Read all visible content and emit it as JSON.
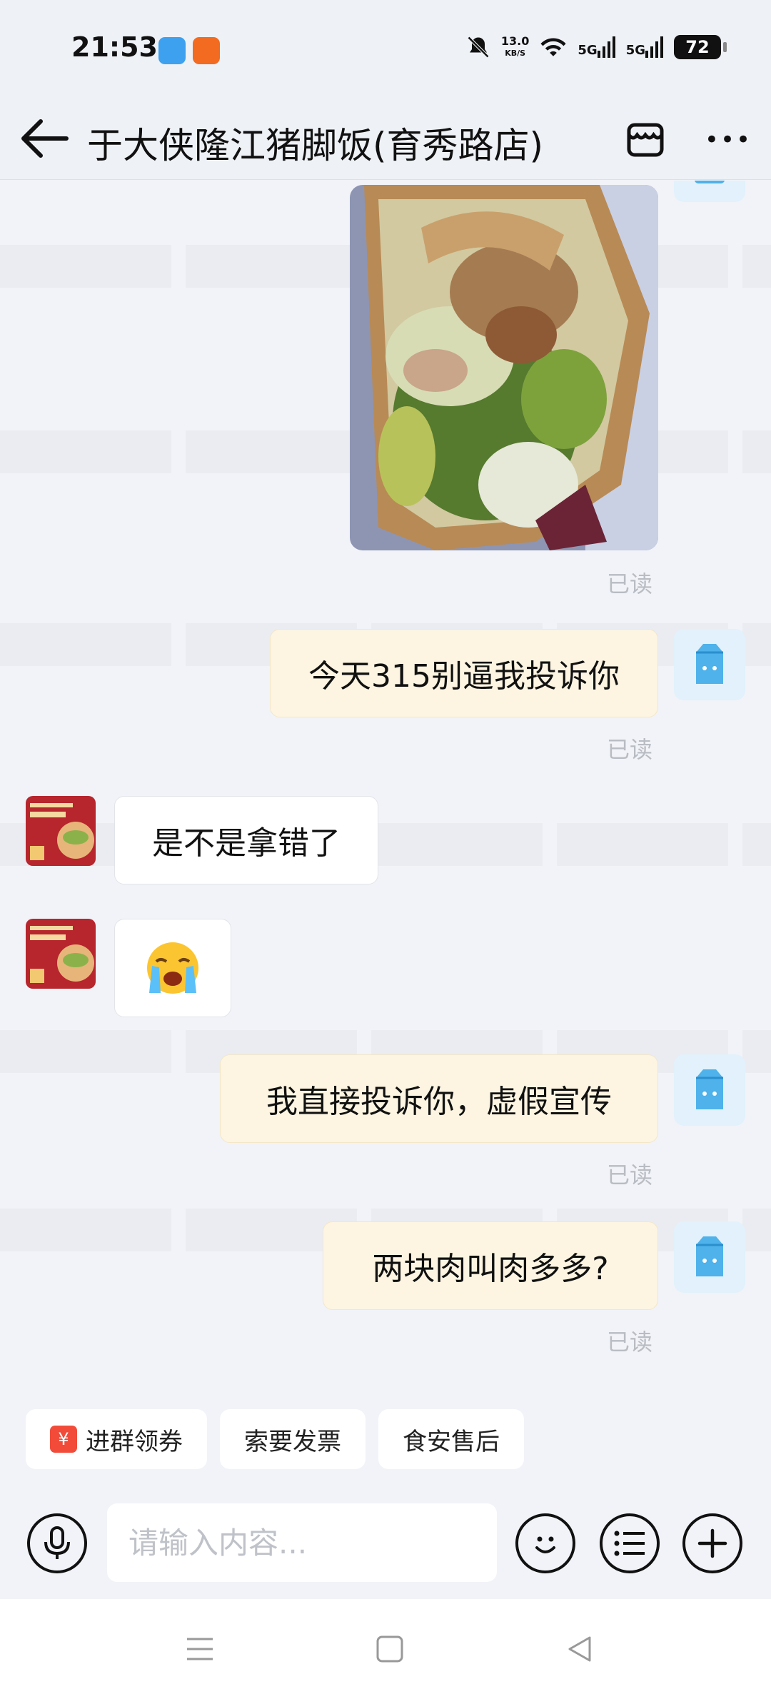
{
  "status_bar": {
    "time": "21:53",
    "app_badges": [
      {
        "name": "taobao-shangou-icon",
        "color": "#3ea1f0"
      },
      {
        "name": "orange-app-icon",
        "color": "#f26b21"
      }
    ],
    "net_speed_value": "13.0",
    "net_speed_unit": "KB/S",
    "network_1": "5G",
    "network_2": "5G",
    "battery": "72"
  },
  "header": {
    "title": "于大侠隆江猪脚饭(育秀路店)"
  },
  "messages": [
    {
      "type": "image",
      "sender": "me",
      "alt": "food-photo",
      "read": "已读"
    },
    {
      "type": "text",
      "sender": "me",
      "text": "今天315别逼我投诉你",
      "read": "已读"
    },
    {
      "type": "text",
      "sender": "shop",
      "text": "是不是拿错了"
    },
    {
      "type": "emoji",
      "sender": "shop",
      "text": "😭"
    },
    {
      "type": "text",
      "sender": "me",
      "text": "我直接投诉你，虚假宣传",
      "read": "已读"
    },
    {
      "type": "text",
      "sender": "me",
      "text": "两块肉叫肉多多?",
      "read": "已读"
    }
  ],
  "quick_actions": [
    {
      "label": "进群领券",
      "icon": "coupon-icon"
    },
    {
      "label": "索要发票"
    },
    {
      "label": "食安售后"
    }
  ],
  "input": {
    "placeholder": "请输入内容..."
  },
  "colors": {
    "background": "#f1f3f8",
    "my_bubble": "#fdf5e2",
    "read_text": "#b9bcc2"
  }
}
